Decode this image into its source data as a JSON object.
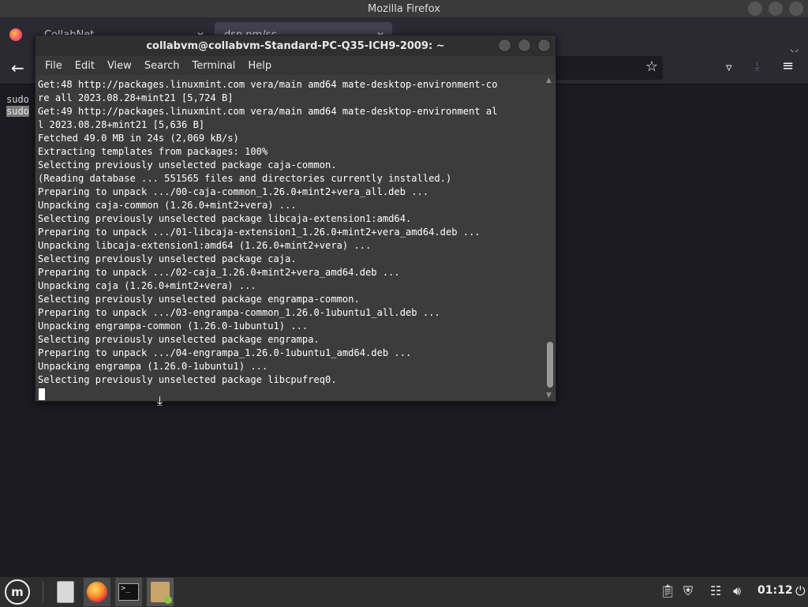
{
  "firefox": {
    "window_title": "Mozilla Firefox",
    "tabs": [
      {
        "label": "CollabNet",
        "close": "✕"
      },
      {
        "label": "dsp.nm/sc",
        "close": "✕"
      }
    ],
    "new_tab": "+",
    "content_lines": [
      "sudo",
      "sudo"
    ]
  },
  "terminal": {
    "title": "collabvm@collabvm-Standard-PC-Q35-ICH9-2009: ~",
    "menu": [
      "File",
      "Edit",
      "View",
      "Search",
      "Terminal",
      "Help"
    ],
    "lines": [
      "Get:48 http://packages.linuxmint.com vera/main amd64 mate-desktop-environment-co",
      "re all 2023.08.28+mint21 [5,724 B]",
      "Get:49 http://packages.linuxmint.com vera/main amd64 mate-desktop-environment al",
      "l 2023.08.28+mint21 [5,636 B]",
      "Fetched 49.0 MB in 24s (2,069 kB/s)",
      "Extracting templates from packages: 100%",
      "Selecting previously unselected package caja-common.",
      "(Reading database ... 551565 files and directories currently installed.)",
      "Preparing to unpack .../00-caja-common_1.26.0+mint2+vera_all.deb ...",
      "Unpacking caja-common (1.26.0+mint2+vera) ...",
      "Selecting previously unselected package libcaja-extension1:amd64.",
      "Preparing to unpack .../01-libcaja-extension1_1.26.0+mint2+vera_amd64.deb ...",
      "Unpacking libcaja-extension1:amd64 (1.26.0+mint2+vera) ...",
      "Selecting previously unselected package caja.",
      "Preparing to unpack .../02-caja_1.26.0+mint2+vera_amd64.deb ...",
      "Unpacking caja (1.26.0+mint2+vera) ...",
      "Selecting previously unselected package engrampa-common.",
      "Preparing to unpack .../03-engrampa-common_1.26.0-1ubuntu1_all.deb ...",
      "Unpacking engrampa-common (1.26.0-1ubuntu1) ...",
      "Selecting previously unselected package engrampa.",
      "Preparing to unpack .../04-engrampa_1.26.0-1ubuntu1_amd64.deb ...",
      "Unpacking engrampa (1.26.0-1ubuntu1) ...",
      "Selecting previously unselected package libcpufreq0."
    ]
  },
  "taskbar": {
    "menu_icon": "mint-logo-icon",
    "apps": [
      "files-icon",
      "firefox-icon",
      "terminal-icon",
      "package-installer-icon"
    ],
    "tray_icons": [
      "clipboard-icon",
      "update-shield-icon",
      "network-icon",
      "volume-icon",
      "power-icon"
    ],
    "clock": "01:12"
  },
  "colors": {
    "terminal_bg": "#3c3c3c",
    "terminal_text": "#ffffff",
    "panel_bg": "#2e2e2e",
    "firefox_bg": "#1c1b22"
  }
}
